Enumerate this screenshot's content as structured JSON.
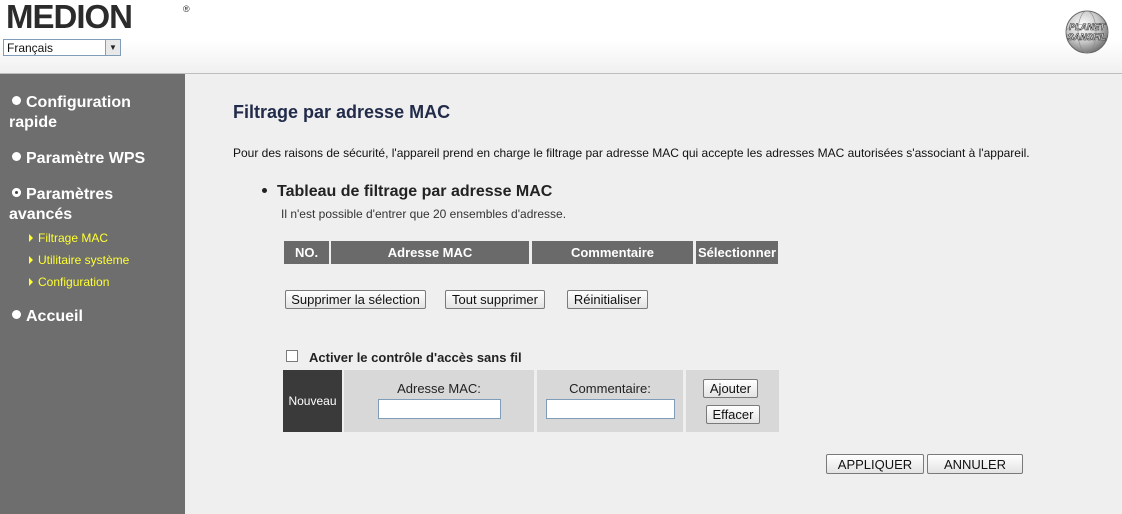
{
  "header": {
    "brand": "MEDION",
    "brand_mark": "®",
    "language_selected": "Français",
    "partner_logo_line1": "PLANET",
    "partner_logo_line2": "SANSFIL"
  },
  "sidebar": {
    "items": [
      {
        "label": "Configuration rapide"
      },
      {
        "label": "Paramètre WPS"
      },
      {
        "label": "Paramètres avancés"
      },
      {
        "label": "Accueil"
      }
    ],
    "sub_items": [
      {
        "label": "Filtrage MAC"
      },
      {
        "label": "Utilitaire système"
      },
      {
        "label": "Configuration"
      }
    ]
  },
  "main": {
    "title": "Filtrage par adresse MAC",
    "description": "Pour des raisons de sécurité, l'appareil prend en charge le filtrage par adresse MAC qui accepte les adresses MAC autorisées s'associant à l'appareil.",
    "section_title": "Tableau de filtrage par adresse MAC",
    "section_note": "Il n'est possible d'entrer que 20 ensembles d'adresse.",
    "table_headers": [
      "NO.",
      "Adresse MAC",
      "Commentaire",
      "Sélectionner"
    ],
    "buttons": {
      "delete_selected": "Supprimer la sélection",
      "delete_all": "Tout supprimer",
      "reset": "Réinitialiser",
      "add": "Ajouter",
      "clear": "Effacer",
      "apply": "APPLIQUER",
      "cancel": "ANNULER"
    },
    "access_control_label": "Activer le contrôle d'accès sans fil",
    "access_control_checked": false,
    "new_entry": {
      "row_label": "Nouveau",
      "mac_label": "Adresse MAC:",
      "mac_value": "",
      "comment_label": "Commentaire:",
      "comment_value": ""
    }
  },
  "colors": {
    "sidebar_bg": "#6e6e6e",
    "submenu_text": "#ffff33",
    "table_header_bg": "#6a6a6a",
    "page_bg": "#efefef",
    "title_color": "#222c4a"
  }
}
